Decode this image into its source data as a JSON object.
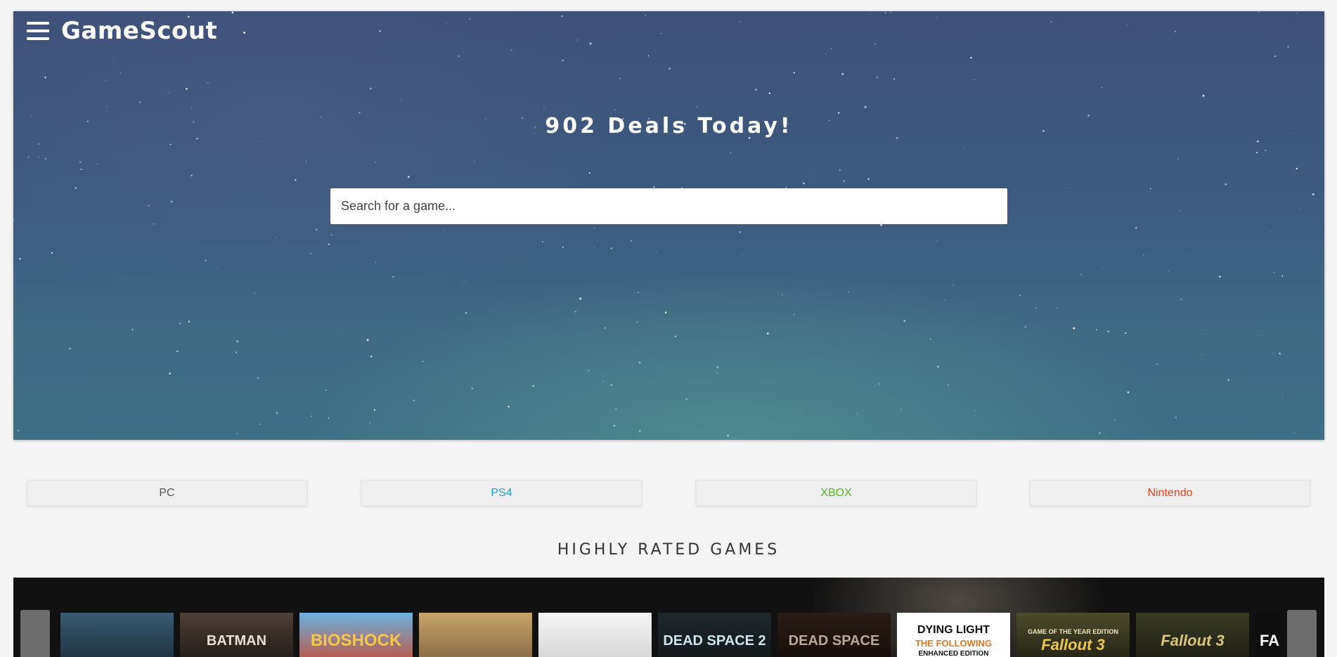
{
  "header": {
    "brand": "GameScout"
  },
  "hero": {
    "headline": "902 Deals Today!"
  },
  "search": {
    "placeholder": "Search for a game..."
  },
  "platforms": [
    {
      "label": "PC",
      "color": "#555555"
    },
    {
      "label": "PS4",
      "color": "#1a9ed9"
    },
    {
      "label": "XBOX",
      "color": "#4cbb17"
    },
    {
      "label": "Nintendo",
      "color": "#e8401c"
    }
  ],
  "highly_rated": {
    "title": "HIGHLY RATED GAMES",
    "games": [
      {
        "title": "",
        "style": "uncharted"
      },
      {
        "title": "BATMAN",
        "style": "batman"
      },
      {
        "title": "BIOSHOCK",
        "style": "bioshock"
      },
      {
        "title": "",
        "style": "mw2"
      },
      {
        "title": "",
        "style": "mw3"
      },
      {
        "title": "DEAD SPACE 2",
        "style": "deadspace2"
      },
      {
        "title": "DEAD SPACE",
        "style": "deadspace"
      },
      {
        "title": "DYING LIGHT",
        "subtitle": "THE FOLLOWING",
        "extra": "ENHANCED EDITION",
        "style": "dyinglight"
      },
      {
        "title": "Fallout 3",
        "subtitle": "GAME OF THE YEAR EDITION",
        "style": "fallout3goty"
      },
      {
        "title": "Fallout 3",
        "style": "fallout3"
      },
      {
        "title": "FA",
        "style": "partial"
      }
    ]
  }
}
